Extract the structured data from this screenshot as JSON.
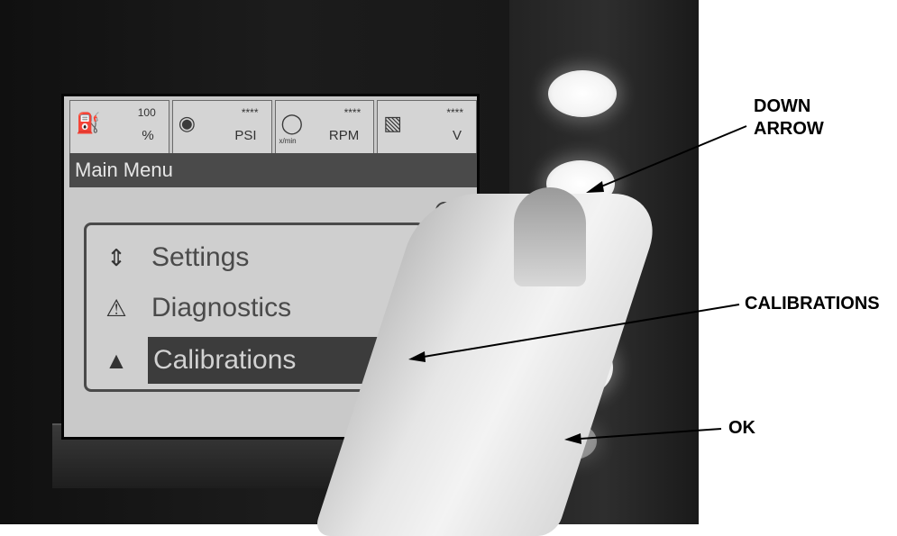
{
  "status_bar": [
    {
      "icon": "fuel-icon",
      "value": "100",
      "unit": "%"
    },
    {
      "icon": "pressure-icon",
      "value": "****",
      "unit": "PSI"
    },
    {
      "icon": "engine-speed-icon",
      "value": "****",
      "unit": "RPM",
      "sub_label": "x/min"
    },
    {
      "icon": "battery-icon",
      "value": "****",
      "unit": "V"
    }
  ],
  "screen": {
    "title": "Main Menu",
    "scroll_up_icon": "up-arrow-icon",
    "menu_items": [
      {
        "label": "Settings",
        "icon": "settings-sliders-icon",
        "selected": false
      },
      {
        "label": "Diagnostics",
        "icon": "warning-triangle-icon",
        "selected": false
      },
      {
        "label": "Calibrations",
        "icon": "triangle-icon",
        "selected": true
      }
    ]
  },
  "callouts": {
    "down_arrow_line1": "DOWN",
    "down_arrow_line2": "ARROW",
    "calibrations": "CALIBRATIONS",
    "ok": "OK"
  },
  "colors": {
    "lcd_background": "#c9c9c9",
    "title_bar": "#4a4a4a",
    "selected_row": "#3c3c3c"
  }
}
